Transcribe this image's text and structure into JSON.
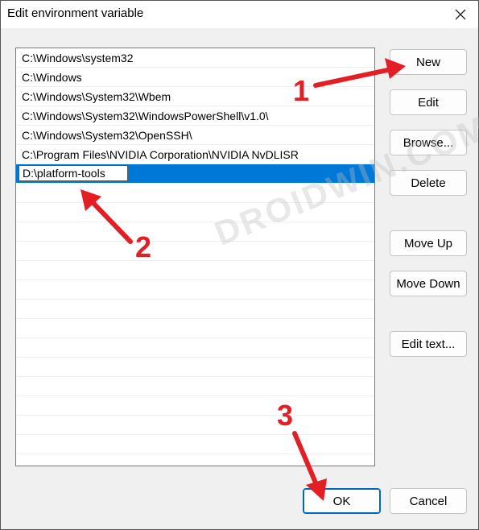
{
  "window": {
    "title": "Edit environment variable"
  },
  "list": {
    "items": [
      "C:\\Windows\\system32",
      "C:\\Windows",
      "C:\\Windows\\System32\\Wbem",
      "C:\\Windows\\System32\\WindowsPowerShell\\v1.0\\",
      "C:\\Windows\\System32\\OpenSSH\\",
      "C:\\Program Files\\NVIDIA Corporation\\NVIDIA NvDLISR"
    ],
    "editing_value": "D:\\platform-tools"
  },
  "buttons": {
    "new": "New",
    "edit": "Edit",
    "browse": "Browse...",
    "delete": "Delete",
    "move_up": "Move Up",
    "move_down": "Move Down",
    "edit_text": "Edit text...",
    "ok": "OK",
    "cancel": "Cancel"
  },
  "annotations": {
    "step1": "1",
    "step2": "2",
    "step3": "3",
    "watermark": "DROIDWIN.COM"
  },
  "colors": {
    "selection": "#0078d7",
    "annotation": "#e31e24"
  }
}
